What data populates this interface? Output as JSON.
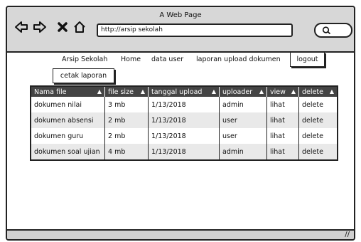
{
  "window": {
    "title": "A Web Page"
  },
  "toolbar": {
    "url": "http://arsip sekolah"
  },
  "menu": {
    "brand": "Arsip Sekolah",
    "home": "Home",
    "data_user": "data user",
    "laporan": "laporan upload dokumen",
    "logout": "logout"
  },
  "actions": {
    "cetak": "cetak laporan"
  },
  "table": {
    "headers": [
      "Nama file",
      "file size",
      "tanggal upload",
      "uploader",
      "view",
      "delete"
    ],
    "rows": [
      [
        "dokumen nilai",
        "3 mb",
        "1/13/2018",
        "admin",
        "lihat",
        "delete"
      ],
      [
        "dokumen absensi",
        "2 mb",
        "1/13/2018",
        "user",
        "lihat",
        "delete"
      ],
      [
        "dokumen guru",
        "2 mb",
        "1/13/2018",
        "user",
        "lihat",
        "delete"
      ],
      [
        "dokumen soal ujian",
        "4 mb",
        "1/13/2018",
        "admin",
        "lihat",
        "delete"
      ]
    ]
  },
  "icons": [
    "back-arrow-icon",
    "forward-arrow-icon",
    "close-icon",
    "home-icon",
    "search-icon",
    "sort-icon",
    "resize-grip-icon"
  ],
  "colors": {
    "header_bg": "#444444",
    "chrome_bg": "#d7d7d7",
    "alt_row": "#e9e9e9"
  }
}
